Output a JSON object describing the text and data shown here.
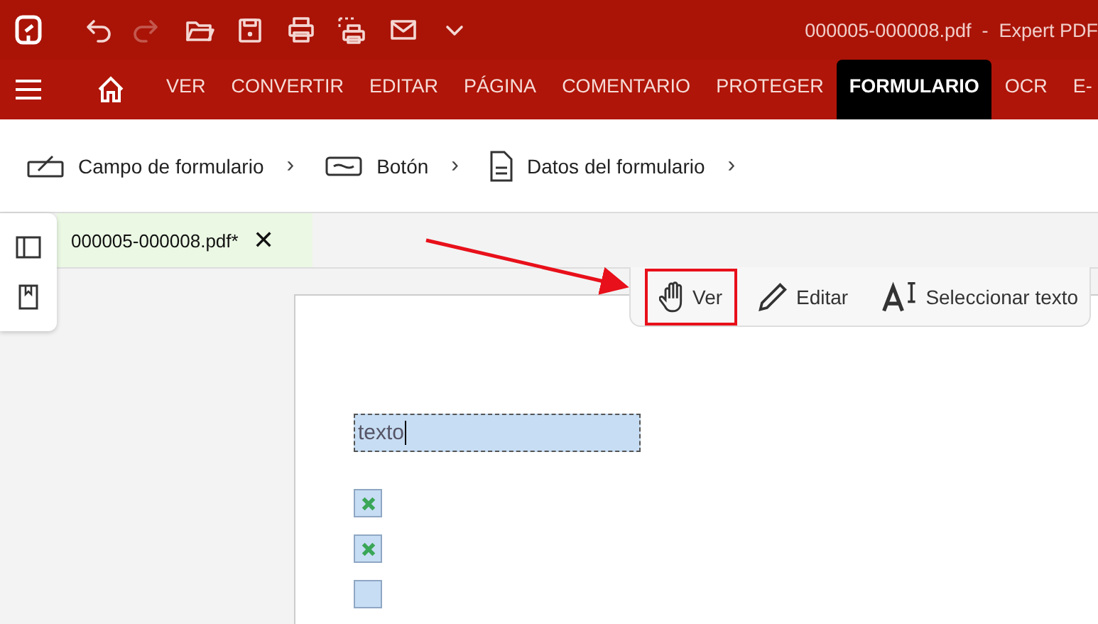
{
  "title_bar": {
    "title": "000005-000008.pdf  -  Expert PDF",
    "quick_actions": [
      {
        "kind": "undo",
        "disabled": false
      },
      {
        "kind": "redo",
        "disabled": true
      },
      {
        "kind": "open",
        "disabled": false
      },
      {
        "kind": "save",
        "disabled": false
      },
      {
        "kind": "print",
        "disabled": false
      },
      {
        "kind": "print-area",
        "disabled": false
      },
      {
        "kind": "mail",
        "disabled": false
      },
      {
        "kind": "more",
        "disabled": false
      }
    ]
  },
  "menu_tabs": [
    {
      "label": "VER",
      "selected": false
    },
    {
      "label": "CONVERTIR",
      "selected": false
    },
    {
      "label": "EDITAR",
      "selected": false
    },
    {
      "label": "PÁGINA",
      "selected": false
    },
    {
      "label": "COMENTARIO",
      "selected": false
    },
    {
      "label": "PROTEGER",
      "selected": false
    },
    {
      "label": "FORMULARIO",
      "selected": true
    },
    {
      "label": "OCR",
      "selected": false
    },
    {
      "label": "E-",
      "selected": false
    }
  ],
  "ribbon": [
    {
      "kind": "field",
      "label": "Campo de formulario",
      "chevron": "›"
    },
    {
      "kind": "button",
      "label": "Botón",
      "chevron": "›"
    },
    {
      "kind": "data",
      "label": "Datos del formulario",
      "chevron": "›"
    }
  ],
  "document_tab": {
    "label": "000005-000008.pdf*",
    "close": "✕"
  },
  "view_toolbar": [
    {
      "kind": "hand",
      "label": "Ver",
      "selected": true
    },
    {
      "kind": "pencil",
      "label": "Editar",
      "selected": false
    },
    {
      "kind": "text",
      "label": "Seleccionar texto",
      "selected": false
    }
  ],
  "form": {
    "text_field": {
      "value": "texto"
    },
    "checkboxes": [
      {
        "checked": true
      },
      {
        "checked": true
      },
      {
        "checked": false
      }
    ]
  }
}
